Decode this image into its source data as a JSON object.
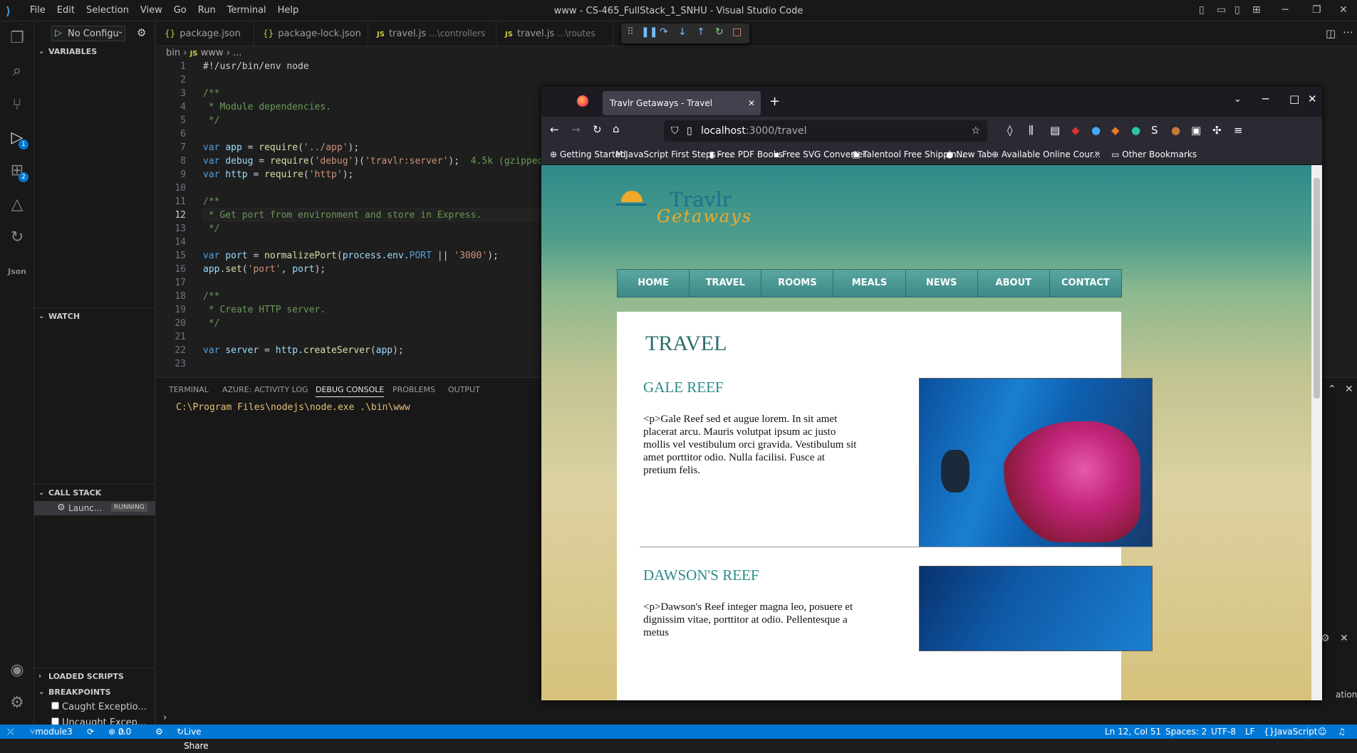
{
  "titlebar": {
    "menu": [
      "File",
      "Edit",
      "Selection",
      "View",
      "Go",
      "Run",
      "Terminal",
      "Help"
    ],
    "title": "www - CS-465_FullStack_1_SNHU - Visual Studio Code"
  },
  "activity": {
    "debug_badge": "1",
    "extensions_badge": "2"
  },
  "sidebar": {
    "run_config": "No Configu",
    "variables": "VARIABLES",
    "watch": "WATCH",
    "callstack": "CALL STACK",
    "callstack_item": "Launc...",
    "callstack_status": "RUNNING",
    "loaded_scripts": "LOADED SCRIPTS",
    "breakpoints": "BREAKPOINTS",
    "bp1": "Caught Exceptio...",
    "bp2": "Uncaught Excep..."
  },
  "tabs": [
    {
      "label": "package.json",
      "sub": ""
    },
    {
      "label": "package-lock.json",
      "sub": ""
    },
    {
      "label": "travel.js",
      "sub": "...\\controllers"
    },
    {
      "label": "travel.js",
      "sub": "...\\routes"
    }
  ],
  "breadcrumb": {
    "a": "bin",
    "b": "www",
    "c": "..."
  },
  "code": {
    "l1": "#!/usr/bin/env node",
    "l3": "/**",
    "l4": " * Module dependencies.",
    "l5": " */",
    "l7a": "var ",
    "l7b": "app",
    " l7c": " = ",
    "l7d": "require",
    "l7e": "('../app');",
    "l8a": "var ",
    "l8b": "debug",
    "l8c": " = ",
    "l8d": "require",
    "l8e": "('debug')('travlr:server');",
    "l8f": "  4.5k (gzipped",
    "l9a": "var ",
    "l9b": "http",
    "l9c": " = ",
    "l9d": "require",
    "l9e": "('http');",
    "l11": "/**",
    "l12": " * Get port from environment and store in Express.",
    "l13": " */",
    "l15a": "var ",
    "l15b": "port",
    " l15c": " = ",
    "l15d": "normalizePort",
    "l15e": "(process.env.",
    "l15f": "PORT",
    " l15g": " || ",
    "l15h": "'3000'",
    "l15i": ");",
    "l16a": "app",
    "l16b": ".set(",
    "l16c": "'port'",
    "l16d": ", port);",
    "l18": "/**",
    "l19": " * Create HTTP server.",
    "l20": " */",
    "l22a": "var ",
    "l22b": "server",
    "l22c": " = ",
    "l22d": "http.createServer",
    "l22e": "(app);"
  },
  "panel": {
    "tabs": [
      "TERMINAL",
      "AZURE: ACTIVITY LOG",
      "DEBUG CONSOLE",
      "PROBLEMS",
      "OUTPUT"
    ],
    "console_line": "C:\\Program Files\\nodejs\\node.exe .\\bin\\www",
    "notification_fragment": "ations"
  },
  "status": {
    "branch": "module3",
    "errors": "0",
    "warnings": "0",
    "liveshare": "Live Share",
    "position": "Ln 12, Col 51",
    "spaces": "Spaces: 2",
    "encoding": "UTF-8",
    "eol": "LF",
    "language": "JavaScript"
  },
  "browser": {
    "tab_title": "Travlr Getaways - Travel",
    "url_host": "localhost",
    "url_path": ":3000/travel",
    "bookmarks": [
      "Getting Started",
      "JavaScript First Steps - ...",
      "Free PDF Books",
      "Free SVG Converter",
      "Talentool Free Shippin...",
      "New Tab",
      "Available Online Cour...",
      "Other Bookmarks"
    ]
  },
  "site": {
    "logo_top": "Travlr",
    "logo_bottom": "Getaways",
    "nav": [
      "HOME",
      "TRAVEL",
      "ROOMS",
      "MEALS",
      "NEWS",
      "ABOUT",
      "CONTACT"
    ],
    "page_title": "TRAVEL",
    "reefs": [
      {
        "name": "GALE REEF",
        "text": "<p>Gale Reef sed et augue lorem. In sit amet placerat arcu. Mauris volutpat ipsum ac justo mollis vel vestibulum orci gravida. Vestibulum sit amet porttitor odio. Nulla facilisi. Fusce at pretium felis."
      },
      {
        "name": "DAWSON'S REEF",
        "text": "<p>Dawson's Reef integer magna leo, posuere et dignissim vitae, porttitor at odio. Pellentesque a metus"
      }
    ]
  }
}
